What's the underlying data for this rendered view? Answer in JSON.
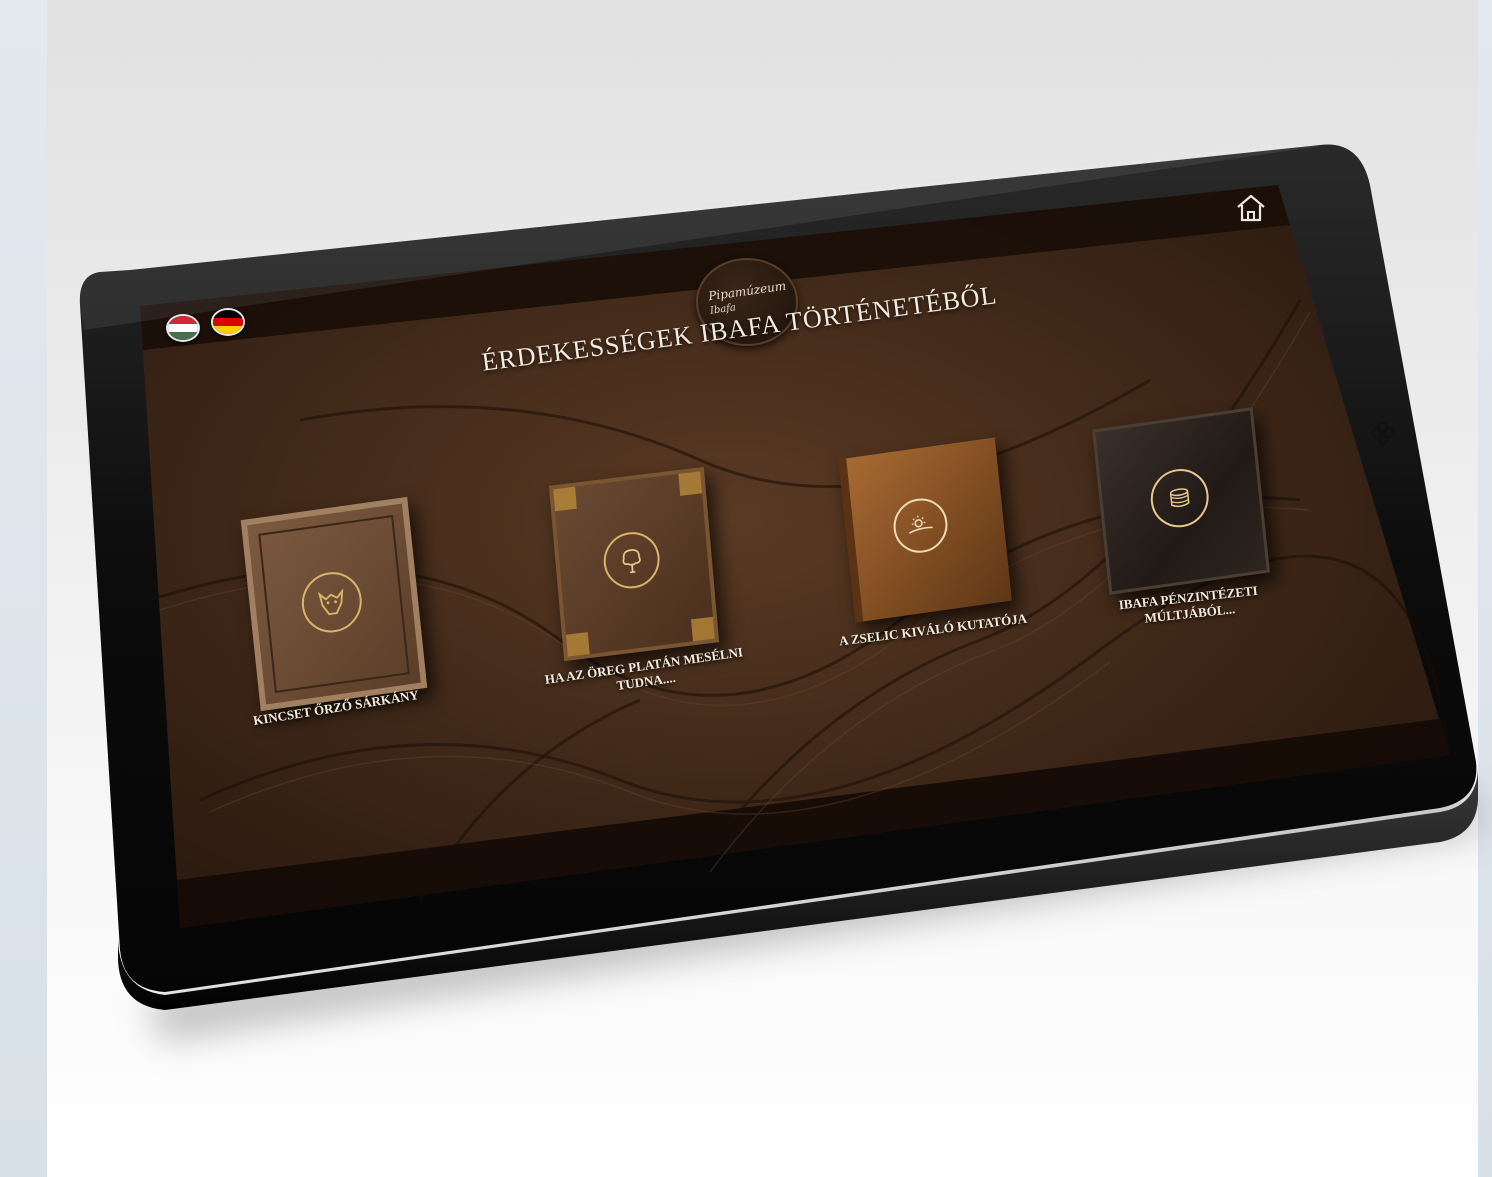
{
  "page": {
    "title": "ÉRDEKESSÉGEK IBAFA TÖRTÉNETÉBŐL"
  },
  "header": {
    "logo": {
      "line1": "Pipamúzeum",
      "line2": "Ibafa"
    },
    "languages": [
      {
        "code": "hu",
        "name": "flag-hungary-icon",
        "colors": [
          "#ce2939",
          "#ffffff",
          "#477050"
        ]
      },
      {
        "code": "de",
        "name": "flag-germany-icon",
        "colors": [
          "#000000",
          "#dd0000",
          "#ffce00"
        ]
      }
    ],
    "home_icon": "home-icon"
  },
  "side_button": {
    "icon": "flower-menu-icon"
  },
  "books": [
    {
      "label": "KINCSET ŐRZŐ SÁRKÁNY",
      "emblem": "dragon-icon",
      "cover": "#6b4a33"
    },
    {
      "label": "HA AZ ÖREG PLATÁN MESÉLNI TUDNA....",
      "emblem": "tree-icon",
      "cover": "#5a3a24"
    },
    {
      "label": "A ZSELIC KIVÁLÓ KUTATÓJA",
      "emblem": "sunrise-icon",
      "cover": "#8b5225"
    },
    {
      "label": "IBAFA PÉNZINTÉZETI MÚLTJÁBÓL...",
      "emblem": "coins-icon",
      "cover": "#2b2320"
    }
  ],
  "colors": {
    "accent_gold": "#d9b46a",
    "text": "#f3ebe0",
    "tablet_frame": "#111111"
  }
}
